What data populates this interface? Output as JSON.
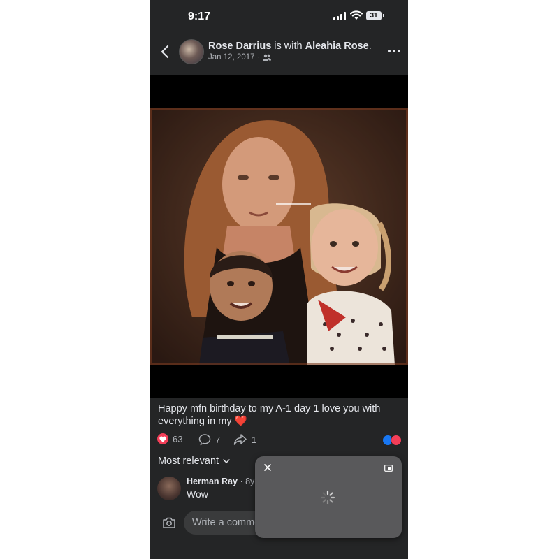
{
  "status_bar": {
    "time": "9:17",
    "battery": "31"
  },
  "header": {
    "author": "Rose Darrius",
    "with_text": " is with ",
    "tagged": "Aleahia Rose",
    "tail": ".",
    "date": "Jan 12, 2017",
    "separator": "·",
    "audience_icon": "friends-icon"
  },
  "post": {
    "caption": "Happy mfn birthday to my A-1 day 1 love you with everything in my",
    "caption_emoji": "❤️",
    "reaction_count": "63",
    "comment_count": "7",
    "share_count": "1"
  },
  "comments": {
    "sort_label": "Most relevant",
    "items": [
      {
        "name": "Herman Ray",
        "time": "· 8y",
        "text": "Wow"
      }
    ]
  },
  "composer": {
    "placeholder": "Write a comment..."
  },
  "colors": {
    "background": "#242526",
    "love": "#f33e58",
    "like": "#1877f2"
  }
}
